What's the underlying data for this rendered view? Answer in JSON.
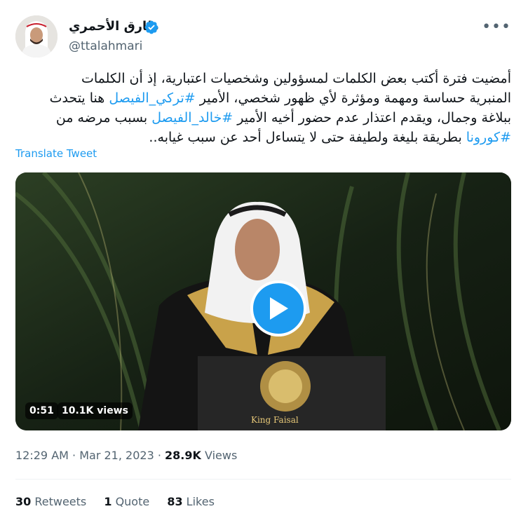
{
  "author": {
    "name": "طارق الأحمري",
    "handle": "@ttalahmari",
    "verified": true
  },
  "tweet": {
    "lines": [
      [
        {
          "t": "أمضيت فترة أكتب بعض الكلمات لمسؤولين وشخصيات اعتبارية، إذ أن الكلمات"
        }
      ],
      [
        {
          "t": "المنبرية حساسة ومهمة ومؤثرة لأي ظهور شخصي، الأمير "
        },
        {
          "t": "#تركي_الفيصل",
          "tag": true
        },
        {
          "t": " هنا يتحدث"
        }
      ],
      [
        {
          "t": "ببلاغة وجمال، ويقدم اعتذار عدم حضور أخيه الأمير "
        },
        {
          "t": "#خالد_الفيصل",
          "tag": true
        },
        {
          "t": " بسبب مرضه من"
        }
      ],
      [
        {
          "t": "#كورونا",
          "tag": true
        },
        {
          "t": " بطريقة بليغة ولطيفة حتى لا يتساءل أحد عن سبب غيابه.."
        }
      ]
    ],
    "translate_label": "Translate Tweet",
    "link_color": "#1d9bf0"
  },
  "video": {
    "duration": "0:51",
    "views": "10.1K views",
    "podium_label": "King Faisal",
    "play_icon": "play-icon"
  },
  "meta": {
    "time": "12:29 AM",
    "sep1": " · ",
    "date": "Mar 21, 2023",
    "sep2": " · ",
    "views_count": "28.9K",
    "views_label": " Views"
  },
  "stats": {
    "retweets_count": "30",
    "retweets_label": " Retweets",
    "quotes_count": "1",
    "quotes_label": " Quote",
    "likes_count": "83",
    "likes_label": " Likes"
  }
}
